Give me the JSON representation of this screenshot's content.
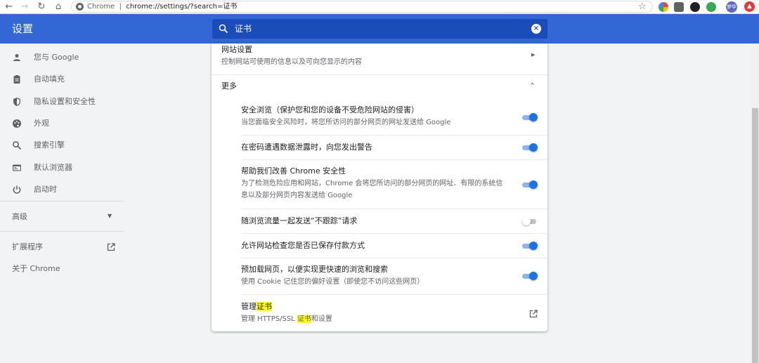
{
  "browser": {
    "omnibox_site": "Chrome",
    "omnibox_sep": "|",
    "omnibox_url": "chrome://settings/?search=证书",
    "avatar_text": "梦华",
    "icons": [
      "back-icon",
      "forward-icon",
      "reload-icon",
      "home-icon",
      "star-icon",
      "extension-icon"
    ]
  },
  "header": {
    "title": "设置",
    "search_value": "证书"
  },
  "sidebar": {
    "items": [
      {
        "label": "您与 Google",
        "icon": "person-icon"
      },
      {
        "label": "自动填充",
        "icon": "clipboard-icon"
      },
      {
        "label": "隐私设置和安全性",
        "icon": "shield-icon"
      },
      {
        "label": "外观",
        "icon": "palette-icon"
      },
      {
        "label": "搜索引擎",
        "icon": "search-icon"
      },
      {
        "label": "默认浏览器",
        "icon": "browser-icon"
      },
      {
        "label": "启动时",
        "icon": "power-icon"
      }
    ],
    "advanced": "高级",
    "extensions": "扩展程序",
    "about": "关于 Chrome"
  },
  "card": {
    "site_settings": {
      "title": "网站设置",
      "subtitle": "控制网站可使用的信息以及可向您显示的内容"
    },
    "more": "更多",
    "toggles": [
      {
        "title": "安全浏览（保护您和您的设备不受危险网站的侵害）",
        "subtitle": "当您面临安全风险时，将您所访问的部分网页的网址发送给 Google",
        "on": true
      },
      {
        "title": "在密码遭遇数据泄露时，向您发出警告",
        "subtitle": "",
        "on": true
      },
      {
        "title": "帮助我们改善 Chrome 安全性",
        "subtitle": "为了检测危险应用和网站，Chrome 会将您所访问的部分网页的网址、有限的系统信息以及部分网页内容发送给 Google",
        "on": true
      },
      {
        "title": "随浏览流量一起发送“不跟踪”请求",
        "subtitle": "",
        "on": false
      },
      {
        "title": "允许网站检查您是否已保存付款方式",
        "subtitle": "",
        "on": true
      },
      {
        "title": "预加载网页，以便实现更快速的浏览和搜索",
        "subtitle": "使用 Cookie 记住您的偏好设置（即使您不访问这些网页）",
        "on": true
      }
    ],
    "manage_certs": {
      "title_prefix": "管理",
      "title_highlight": "证书",
      "sub_prefix": "管理 HTTPS/SSL ",
      "sub_highlight": "证书",
      "sub_suffix": "和设置"
    }
  },
  "colors": {
    "header_bg": "#3367d6",
    "search_bg": "#1a4cba",
    "toggle_on": "#1a73e8",
    "highlight": "#ffff00"
  }
}
